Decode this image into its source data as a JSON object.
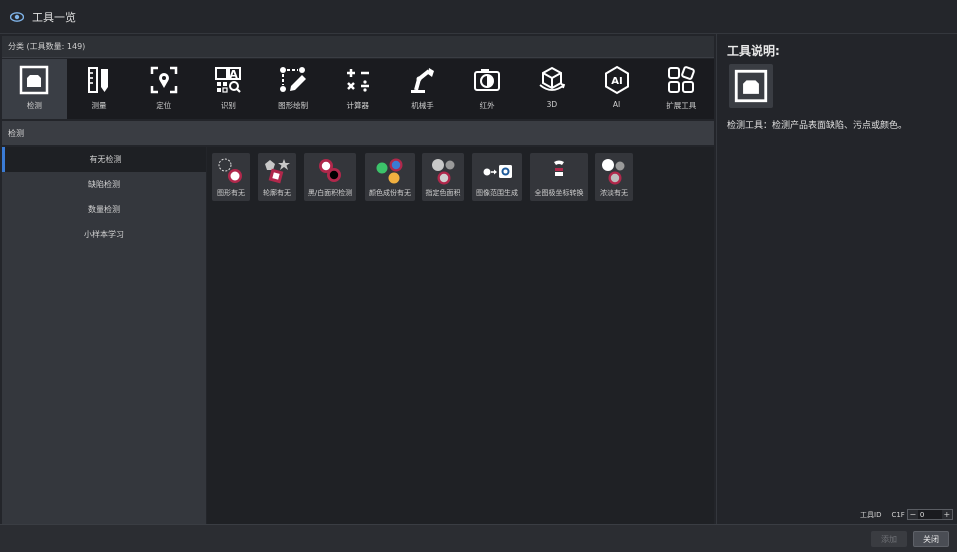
{
  "window": {
    "title": "工具一览",
    "app_icon": "eye-icon"
  },
  "category": {
    "header": "分类 (工具数量: 149)",
    "items": [
      {
        "label": "检测",
        "icon": "inspection-icon",
        "active": true
      },
      {
        "label": "测量",
        "icon": "ruler-pen-icon"
      },
      {
        "label": "定位",
        "icon": "locate-icon"
      },
      {
        "label": "识别",
        "icon": "recognize-icon"
      },
      {
        "label": "图形绘制",
        "icon": "draw-shape-icon"
      },
      {
        "label": "计算器",
        "icon": "calculator-icon"
      },
      {
        "label": "机械手",
        "icon": "robot-arm-icon"
      },
      {
        "label": "红外",
        "icon": "infrared-icon"
      },
      {
        "label": "3D",
        "icon": "3d-icon"
      },
      {
        "label": "AI",
        "icon": "ai-icon"
      },
      {
        "label": "扩展工具",
        "icon": "extension-icon"
      }
    ]
  },
  "subcategory": {
    "header": "检测",
    "items": [
      {
        "label": "有无检测",
        "active": true
      },
      {
        "label": "缺陷检测"
      },
      {
        "label": "数量检测"
      },
      {
        "label": "小样本学习"
      }
    ]
  },
  "tools": [
    {
      "label": "图形有无",
      "icon": "shape-presence-icon"
    },
    {
      "label": "轮廓有无",
      "icon": "contour-presence-icon"
    },
    {
      "label": "黑/白面积检测",
      "icon": "bw-area-icon"
    },
    {
      "label": "颜色成份有无",
      "icon": "color-component-icon"
    },
    {
      "label": "指定色面积",
      "icon": "specified-color-area-icon"
    },
    {
      "label": "图像范围生成",
      "icon": "image-range-icon"
    },
    {
      "label": "全图极坐标转换",
      "icon": "polar-transform-icon"
    },
    {
      "label": "浓淡有无",
      "icon": "shade-presence-icon"
    }
  ],
  "description": {
    "title": "工具说明:",
    "icon": "inspection-icon",
    "text": "检测工具：检测产品表面缺陷、污点或颜色。"
  },
  "tool_id": {
    "label": "工具ID",
    "prefix": "C1F",
    "value": "0",
    "minus": "−",
    "plus": "+"
  },
  "buttons": {
    "add": "添加",
    "close": "关闭"
  },
  "colors": {
    "accent": "#3a7bd5",
    "tool_red": "#b0284b"
  }
}
